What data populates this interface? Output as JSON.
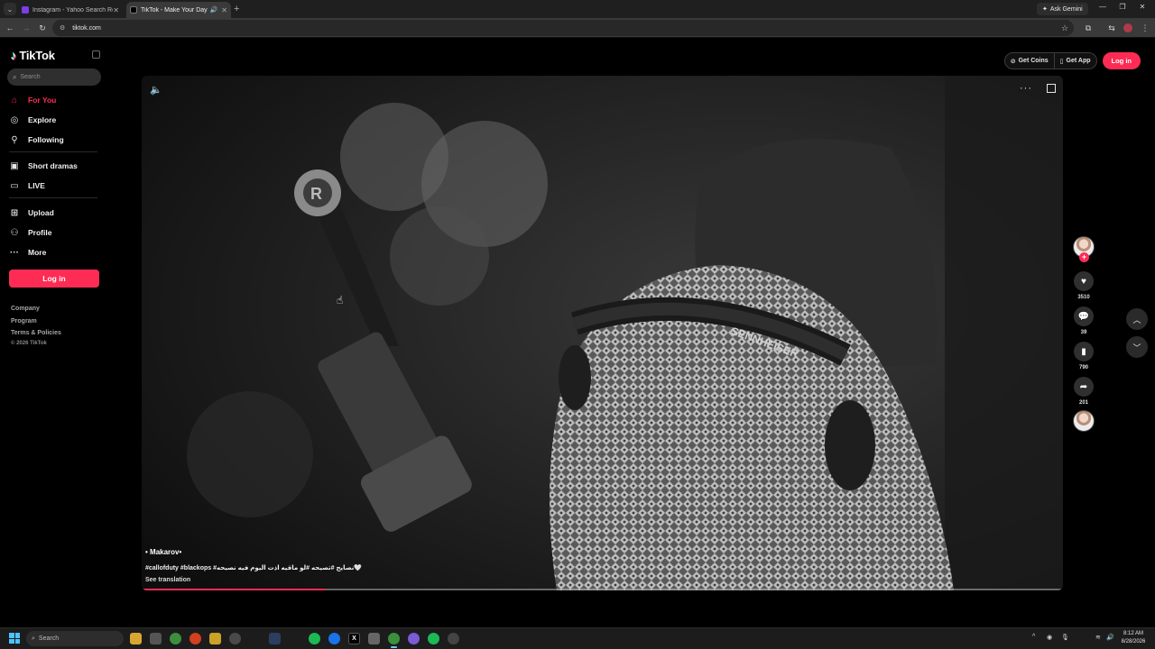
{
  "browser": {
    "tabs": [
      {
        "title": "Instagram - Yahoo Search Res...",
        "favicon_color": "#7b3fe4",
        "active": false
      },
      {
        "title": "TikTok - Make Your Day",
        "favicon_color": "#000000",
        "active": true
      }
    ],
    "new_tab_label": "+",
    "ask_gemini_label": "Ask Gemini",
    "url": "tiktok.com"
  },
  "sidebar": {
    "logo_text": "TikTok",
    "search_placeholder": "Search",
    "nav_items": [
      {
        "label": "For You",
        "icon": "home-icon",
        "active": true
      },
      {
        "label": "Explore",
        "icon": "compass-icon"
      },
      {
        "label": "Following",
        "icon": "person-icon"
      },
      {
        "label": "Short dramas",
        "icon": "film-icon"
      },
      {
        "label": "LIVE",
        "icon": "live-icon"
      },
      {
        "label": "Upload",
        "icon": "plus-square-icon"
      },
      {
        "label": "Profile",
        "icon": "user-icon"
      },
      {
        "label": "More",
        "icon": "more-dots-icon"
      }
    ],
    "login_label": "Log in",
    "footer_links": [
      "Company",
      "Program",
      "Terms & Policies"
    ],
    "copyright": "© 2026 TikTok"
  },
  "header": {
    "get_coins_label": "Get Coins",
    "get_app_label": "Get App",
    "login_label": "Log in"
  },
  "video": {
    "author": "• Makarov•",
    "caption": "#callofduty #blackops #نصايح #تصيحه #لو ماقيه اذت اليوم فيه نصيحه🤍",
    "see_translation": "See translation",
    "progress": 0.2
  },
  "actions": {
    "likes": "3510",
    "comments": "39",
    "saves": "790",
    "shares": "201"
  },
  "taskbar": {
    "search_label": "Search",
    "time": "8:12 AM",
    "date": "8/28/2026"
  },
  "colors": {
    "brand": "#fe2c55",
    "background": "#000000",
    "tab_strip": "#1f1f1f"
  }
}
